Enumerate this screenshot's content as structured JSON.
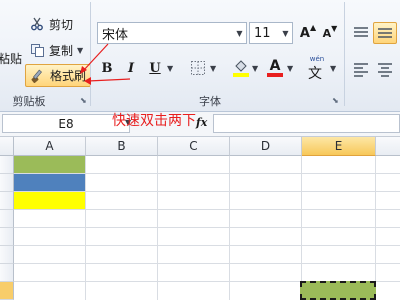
{
  "ribbon": {
    "clipboard": {
      "paste_label": "粘贴",
      "cut_label": "剪切",
      "copy_label": "复制",
      "format_painter_label": "格式刷",
      "group_label": "剪贴板"
    },
    "font": {
      "font_name": "宋体",
      "font_size": "11",
      "bold": "B",
      "italic": "I",
      "underline": "U",
      "wen_label": "文",
      "group_label": "字体",
      "grow_font": "A",
      "shrink_font": "A"
    }
  },
  "formula_bar": {
    "name_box": "E8",
    "fx_label": "fx",
    "formula": ""
  },
  "annotation": {
    "text": "快速双击两下",
    "color": "#e81f1f"
  },
  "sheet": {
    "columns": [
      "A",
      "B",
      "C",
      "D",
      "E"
    ],
    "active_column": "E",
    "active_cell": "E8",
    "fills": {
      "A1": "#9bbb59",
      "A2": "#4f81bd",
      "A3": "#ffff00",
      "E8": "#9bbb59"
    }
  },
  "colors": {
    "accent_highlight": "#ffd57a",
    "annotation_red": "#e81f1f"
  }
}
